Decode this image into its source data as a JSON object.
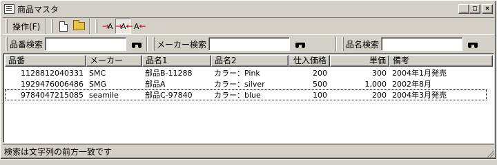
{
  "window": {
    "title": "商品マスタ",
    "minimize_glyph": "_",
    "maximize_glyph": "□",
    "close_glyph": "×"
  },
  "toolbar": {
    "operation_menu_label": "操作(F)",
    "button_a1": "A",
    "button_a2": "A",
    "button_a3": "A"
  },
  "search": {
    "part_number_label": "品番検索",
    "part_number_value": "",
    "maker_label": "メーカー検索",
    "maker_value": "",
    "name_label": "品名検索",
    "name_value": ""
  },
  "table": {
    "columns": [
      "品番",
      "メーカー",
      "品名1",
      "品名2",
      "仕入価格",
      "単価",
      "備考"
    ],
    "rows": [
      [
        "1128812040331",
        "SMC",
        "部品B-11288",
        "カラー：Pink",
        "200",
        "300",
        "2004年1月発売"
      ],
      [
        "1929476006486",
        "SMG",
        "部品A",
        "カラー：silver",
        "500",
        "1,000",
        "2002年8月"
      ],
      [
        "9784047215085",
        "seamile",
        "部品C-97840",
        "カラー：blue",
        "100",
        "200",
        "2004年3月発売"
      ]
    ]
  },
  "status": {
    "text": "検索は文字列の前方一致です"
  }
}
